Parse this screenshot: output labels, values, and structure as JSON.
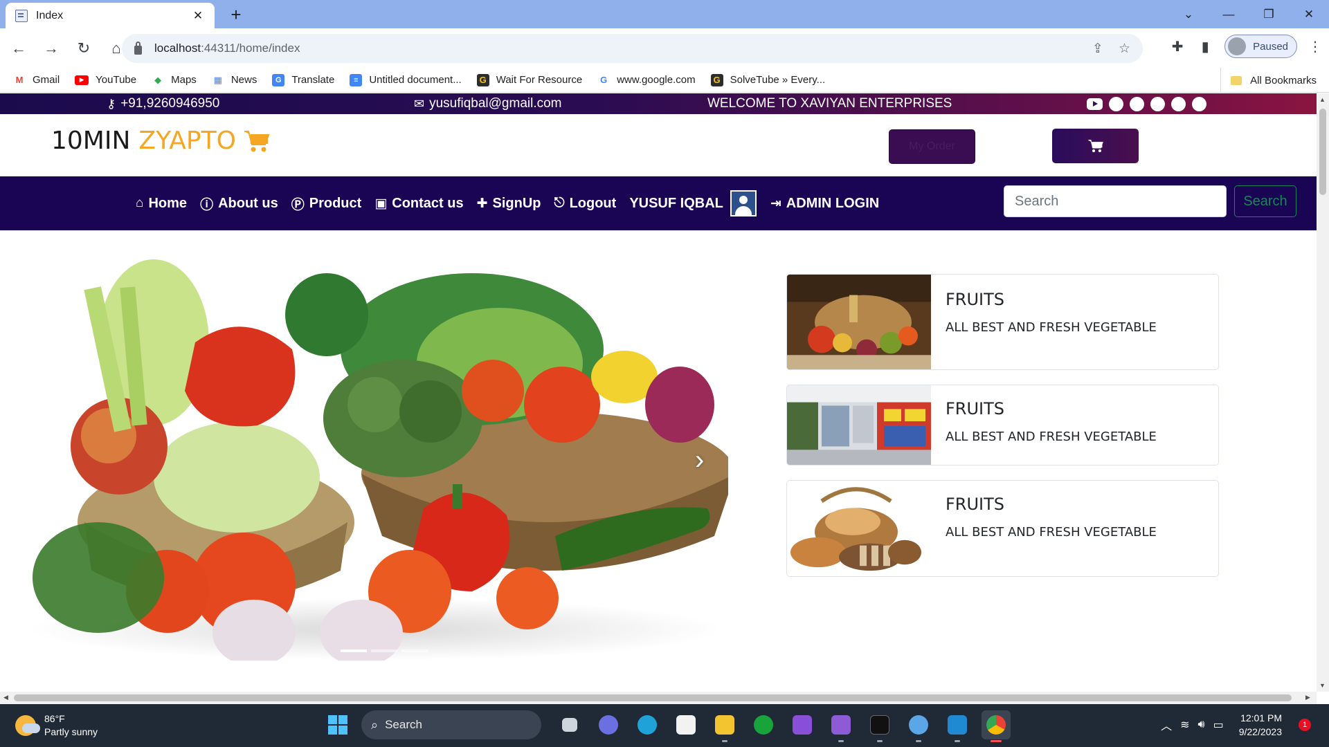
{
  "browser": {
    "tab_title": "Index",
    "url_host": "localhost",
    "url_path": ":44311/home/index",
    "profile_status": "Paused",
    "bookmarks": [
      {
        "label": "Gmail",
        "icon": "gmail-icon",
        "color": "#ea4335"
      },
      {
        "label": "YouTube",
        "icon": "youtube-icon",
        "color": "#ff0000"
      },
      {
        "label": "Maps",
        "icon": "maps-icon",
        "color": "#34a853"
      },
      {
        "label": "News",
        "icon": "news-icon",
        "color": "#4285f4"
      },
      {
        "label": "Translate",
        "icon": "translate-icon",
        "color": "#4285f4"
      },
      {
        "label": "Untitled document...",
        "icon": "docs-icon",
        "color": "#4285f4"
      },
      {
        "label": "Wait For Resource",
        "icon": "g-icon",
        "color": "#2d2d2d"
      },
      {
        "label": "www.google.com",
        "icon": "google-icon",
        "color": "#4285f4"
      },
      {
        "label": "SolveTube » Every...",
        "icon": "g-icon",
        "color": "#2d2d2d"
      }
    ],
    "all_bookmarks": "All Bookmarks"
  },
  "topbar": {
    "phone": "+91,9260946950",
    "email": "yusufiqbal@gmail.com",
    "welcome": "WELCOME TO XAVIYAN ENTERPRISES",
    "social_icons": [
      "youtube-icon",
      "facebook-icon",
      "whatsapp-icon",
      "twitter-icon",
      "github-icon",
      "messenger-icon"
    ]
  },
  "brand": {
    "logo_main": "10MIN",
    "logo_accent": "ZYAPTO",
    "accent_color": "#f5a623",
    "myorder_label": "My Order"
  },
  "nav": {
    "items": [
      {
        "label": "Home",
        "icon": "home-icon",
        "glyph": "⌂"
      },
      {
        "label": "About us",
        "icon": "info-icon",
        "glyph": "ℹ"
      },
      {
        "label": "Product",
        "icon": "product-icon",
        "glyph": "Ⓟ"
      },
      {
        "label": "Contact us",
        "icon": "contact-icon",
        "glyph": "▣"
      },
      {
        "label": "SignUp",
        "icon": "user-plus-icon",
        "glyph": "👤"
      },
      {
        "label": "Logout",
        "icon": "logout-icon",
        "glyph": "⎋"
      }
    ],
    "username": "YUSUF IQBAL",
    "admin_login": "ADMIN LOGIN",
    "search_placeholder": "Search",
    "search_button": "Search",
    "nav_color": "#1a0554"
  },
  "cards": [
    {
      "title": "FRUITS",
      "text": "ALL BEST AND FRESH VEGETABLE",
      "image": "produce-basket"
    },
    {
      "title": "FRUITS",
      "text": "ALL BEST AND FRESH VEGETABLE",
      "image": "supermarket-aisle"
    },
    {
      "title": "FRUITS",
      "text": "ALL BEST AND FRESH VEGETABLE",
      "image": "bread-basket"
    }
  ],
  "carousel": {
    "slides": 3,
    "active_slide": 1
  },
  "taskbar": {
    "temperature": "86°F",
    "weather": "Partly sunny",
    "search": "Search",
    "time": "12:01 PM",
    "date": "9/22/2023",
    "notifications": "1"
  }
}
